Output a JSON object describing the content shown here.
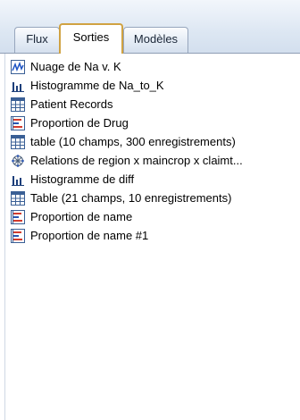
{
  "tabs": [
    {
      "label": "Flux",
      "active": false
    },
    {
      "label": "Sorties",
      "active": true
    },
    {
      "label": "Modèles",
      "active": false
    }
  ],
  "items": [
    {
      "label": "Nuage de Na v. K",
      "icon": "plot-icon"
    },
    {
      "label": "Histogramme de Na_to_K",
      "icon": "histogram-icon"
    },
    {
      "label": "Patient Records",
      "icon": "table-icon"
    },
    {
      "label": "Proportion de Drug",
      "icon": "distribution-icon"
    },
    {
      "label": "table (10 champs, 300 enregistrements)",
      "icon": "table-icon"
    },
    {
      "label": "Relations de region x maincrop x claimt...",
      "icon": "web-icon"
    },
    {
      "label": "Histogramme de diff",
      "icon": "histogram-icon"
    },
    {
      "label": "Table (21 champs, 10 enregistrements)",
      "icon": "table-icon"
    },
    {
      "label": "Proportion de name",
      "icon": "distribution-icon"
    },
    {
      "label": "Proportion de name #1",
      "icon": "distribution-icon"
    }
  ],
  "colors": {
    "active_tab_border": "#d0a242",
    "icon_border": "#3a5f95",
    "tab_strip": "#dde7f3"
  }
}
